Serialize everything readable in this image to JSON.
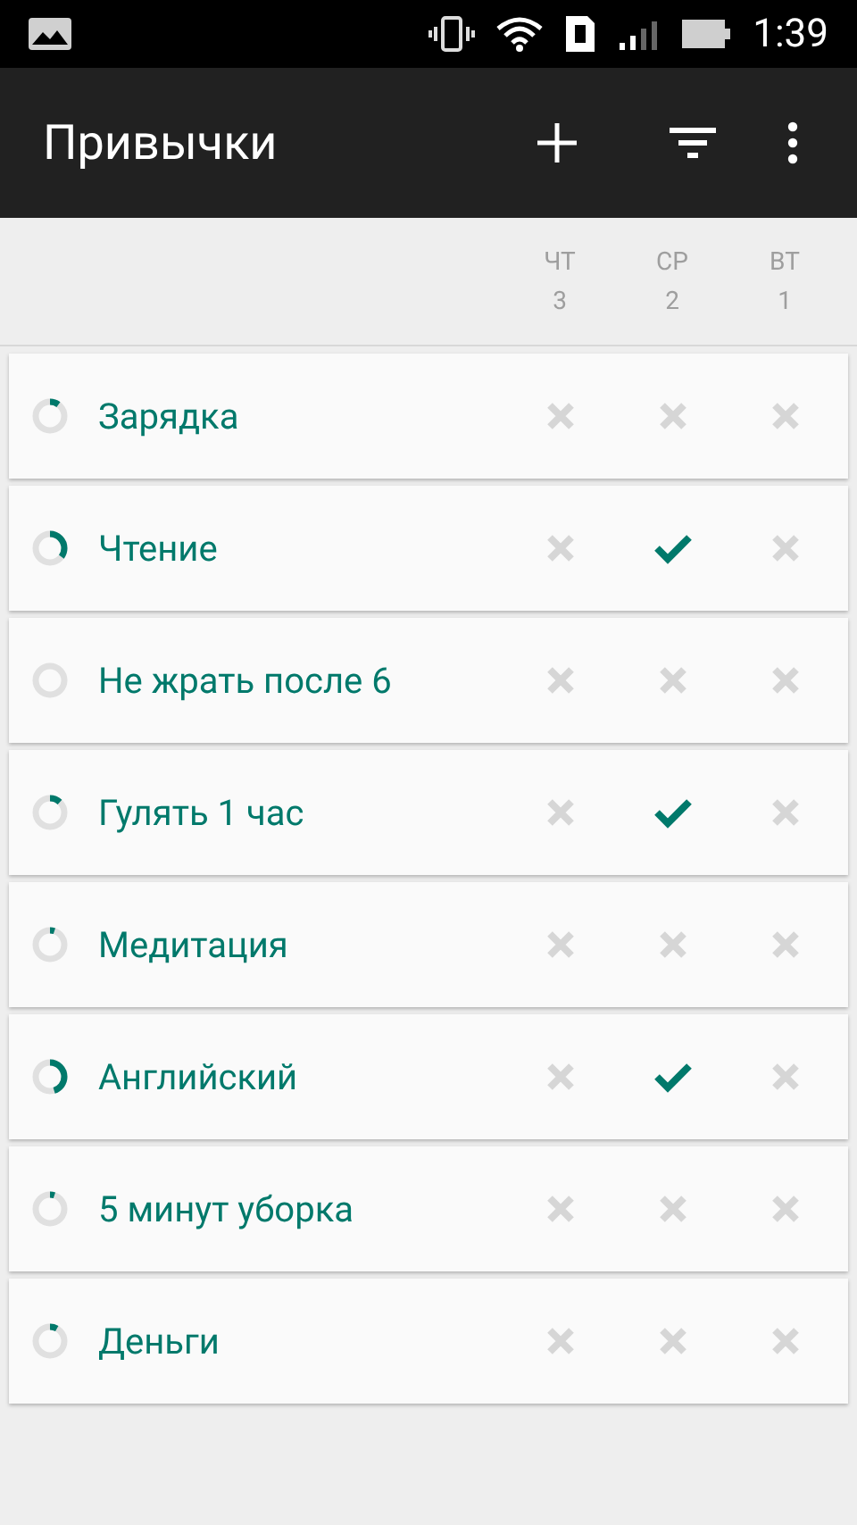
{
  "status_bar": {
    "time": "1:39"
  },
  "app_bar": {
    "title": "Привычки"
  },
  "days": [
    {
      "weekday": "ЧТ",
      "date": "3"
    },
    {
      "weekday": "СР",
      "date": "2"
    },
    {
      "weekday": "ВТ",
      "date": "1"
    }
  ],
  "habits": [
    {
      "name": "Зарядка",
      "level": 0.1,
      "checks": [
        {
          "checked": false
        },
        {
          "checked": false
        },
        {
          "checked": false
        }
      ]
    },
    {
      "name": "Чтение",
      "level": 0.35,
      "checks": [
        {
          "checked": false
        },
        {
          "checked": true
        },
        {
          "checked": false
        }
      ]
    },
    {
      "name": "Не жрать после 6",
      "level": 0,
      "checks": [
        {
          "checked": false
        },
        {
          "checked": false
        },
        {
          "checked": false
        }
      ]
    },
    {
      "name": "Гулять 1 час",
      "level": 0.12,
      "checks": [
        {
          "checked": false
        },
        {
          "checked": true
        },
        {
          "checked": false
        }
      ]
    },
    {
      "name": "Медитация",
      "level": 0.05,
      "checks": [
        {
          "checked": false
        },
        {
          "checked": false
        },
        {
          "checked": false
        }
      ]
    },
    {
      "name": "Английский",
      "level": 0.45,
      "checks": [
        {
          "checked": false
        },
        {
          "checked": true
        },
        {
          "checked": false
        }
      ]
    },
    {
      "name": "5 минут уборка",
      "level": 0.05,
      "checks": [
        {
          "checked": false
        },
        {
          "checked": false
        },
        {
          "checked": false
        }
      ]
    },
    {
      "name": "Деньги",
      "level": 0.08,
      "checks": [
        {
          "checked": false
        },
        {
          "checked": false
        },
        {
          "checked": false
        }
      ]
    }
  ]
}
